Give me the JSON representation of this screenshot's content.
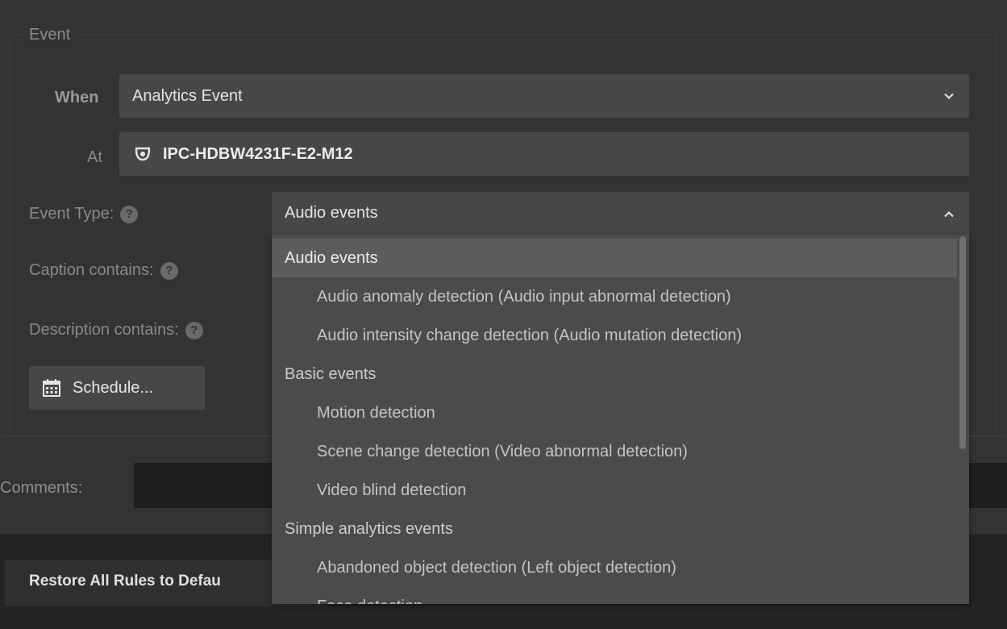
{
  "event_group": {
    "title": "Event",
    "when_label": "When",
    "when_value": "Analytics Event",
    "at_label": "At",
    "at_value": "IPC-HDBW4231F-E2-M12",
    "event_type_label": "Event Type:",
    "event_type_value": "Audio events",
    "caption_label": "Caption contains:",
    "description_label": "Description contains:",
    "schedule_label": "Schedule...",
    "help_glyph": "?"
  },
  "comments_label": "Comments:",
  "restore_label": "Restore All Rules to Defau",
  "icons": {
    "chevron_down": "chevron-down-icon",
    "chevron_up": "chevron-up-icon",
    "camera": "dome-camera-icon",
    "calendar": "calendar-icon",
    "help": "help-icon"
  },
  "dropdown": {
    "items": [
      {
        "label": "Audio events",
        "kind": "group",
        "selected": true
      },
      {
        "label": "Audio anomaly detection (Audio input abnormal detection)",
        "kind": "child"
      },
      {
        "label": "Audio intensity change detection (Audio mutation detection)",
        "kind": "child"
      },
      {
        "label": "Basic events",
        "kind": "group"
      },
      {
        "label": "Motion detection",
        "kind": "child"
      },
      {
        "label": "Scene change detection (Video abnormal detection)",
        "kind": "child"
      },
      {
        "label": "Video blind detection",
        "kind": "child"
      },
      {
        "label": "Simple analytics events",
        "kind": "group"
      },
      {
        "label": "Abandoned object detection (Left object detection)",
        "kind": "child"
      },
      {
        "label": "Face detection",
        "kind": "child"
      }
    ]
  }
}
